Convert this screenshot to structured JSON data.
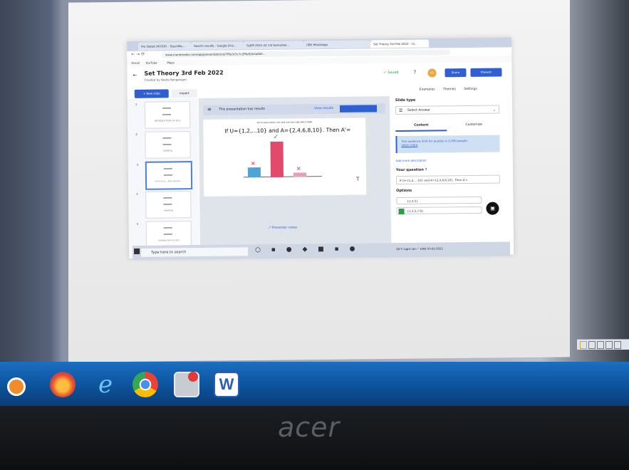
{
  "tabs": [
    {
      "label": "Pre Tablet (M.PDF) - TeachMe..."
    },
    {
      "label": "Search results - Google Driv..."
    },
    {
      "label": "SLEM 2021-22 1st Semester..."
    },
    {
      "label": "(98) WhatsApp"
    },
    {
      "label": "Set Theory 3rd Feb 2022 - sli...",
      "active": true
    }
  ],
  "address": "www.mentimeter.com/app/presentation/al7f0a3c5c7c2f0e92b4a8d4...",
  "bookmarks": [
    "Gmail",
    "YouTube",
    "Maps"
  ],
  "header": {
    "title": "Set Theory 3rd Feb 2022",
    "subtitle": "Created by Neeta Rengarajan",
    "saved": "Saved",
    "avatar": "KS",
    "share": "Share",
    "present": "Present"
  },
  "toolbar": {
    "new_slide": "+ New slide",
    "import": "Import",
    "examples": "Examples",
    "themes": "Themes",
    "settings": "Settings"
  },
  "slides": [
    {
      "num": "1",
      "caption": "INTRODUCTION TO SETS"
    },
    {
      "num": "2",
      "caption": "Heading"
    },
    {
      "num": "3",
      "caption": "If U={1,2,...10} and A=..."
    },
    {
      "num": "4",
      "caption": "Heading"
    },
    {
      "num": "5",
      "caption": "Introduction to sets"
    }
  ],
  "canvas": {
    "results_text": "This presentation has results",
    "view_results": "View results",
    "hint": "Go to www.menti.com and use the code 9653 5988",
    "question": "If U={1,2,...10} and A={2,4,6,8,10}. Then A'=",
    "present_notes": "Presenter notes"
  },
  "chart_data": {
    "type": "bar",
    "categories": [
      "",
      "",
      ""
    ],
    "values": [
      18,
      62,
      8
    ],
    "correct": [
      false,
      true,
      false
    ],
    "ylim": [
      0,
      70
    ],
    "colors": [
      "#4fa3d9",
      "#e14a6a",
      "#e6a0b0"
    ]
  },
  "panel": {
    "slide_type": "Slide type",
    "select_value": "Select Answer",
    "tab_content": "Content",
    "tab_customize": "Customize",
    "info": "The audience limit for quizzes is 2,000 people.",
    "learn_more": "Learn more",
    "add_desc": "Add more description",
    "your_question": "Your question",
    "question_value": "If U={1,2,... 10} and A={2,4,6,8,10}. Then A'=",
    "options_label": "Options",
    "option_1": "{1,3,5}",
    "option_2": "{1,3,5,7,9}"
  },
  "ptaskbar": {
    "search": "Type here to search",
    "tray": "28°C Light rain  ^  ENG  03-02-2022"
  },
  "brand": "acer"
}
